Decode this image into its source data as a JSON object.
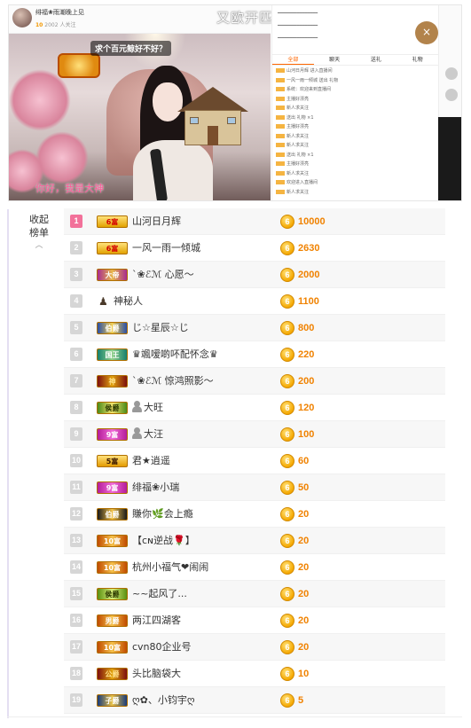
{
  "stream": {
    "anchor_name": "绯福❀雨潮晚上见",
    "anchor_meta_level": "10",
    "anchor_meta_text": "2002 人关注",
    "watermark": "又欧开匹哦走",
    "bubble": "求个百元鲸好不好？",
    "subtitle": "你好，我是大神",
    "subtitle_ghost": "……",
    "close_label": "×",
    "chat_tabs": [
      "全部",
      "聊天",
      "送礼",
      "礼物"
    ],
    "chat_lines": [
      "山河日月辉 进入直播间",
      "一风一雨一倾城 送出 礼物",
      "系统：欢迎来到直播间",
      "主播好漂亮",
      "新人求关注",
      "送出 礼物 ×1",
      "主播好漂亮",
      "新人求关注",
      "新人求关注",
      "送出 礼物 ×1",
      "主播好漂亮",
      "新人求关注",
      "欢迎进入直播间",
      "新人求关注"
    ]
  },
  "ranking": {
    "collapse_label": [
      "收起",
      "榜单"
    ],
    "collapse_icon": "︿",
    "coin_label": "6",
    "rows": [
      {
        "rank": "1",
        "badge": "6富",
        "badge_style": "b-red",
        "icon": "",
        "name": "山河日月辉",
        "value": "10000"
      },
      {
        "rank": "2",
        "badge": "6富",
        "badge_style": "b-red",
        "icon": "",
        "name": "一风一雨一倾城",
        "value": "2630"
      },
      {
        "rank": "3",
        "badge": "大帝",
        "badge_style": "b-purple",
        "icon": "",
        "name": "`❀ℰℳ 心愿～",
        "value": "2000"
      },
      {
        "rank": "4",
        "badge": "",
        "badge_style": "",
        "icon": "mystery",
        "name": "神秘人",
        "value": "1100"
      },
      {
        "rank": "5",
        "badge": "伯爵",
        "badge_style": "b-blue",
        "icon": "",
        "name": "じ☆星辰☆じ",
        "value": "800"
      },
      {
        "rank": "6",
        "badge": "国王",
        "badge_style": "b-teal",
        "icon": "",
        "name": "♛颯嗳啲吥配怀念♛",
        "value": "220"
      },
      {
        "rank": "7",
        "badge": "神",
        "badge_style": "b-darkred",
        "icon": "",
        "name": "`❀ℰℳ 惊鸿照影～",
        "value": "200"
      },
      {
        "rank": "8",
        "badge": "侯爵",
        "badge_style": "b-green",
        "icon": "person",
        "name": "大旺",
        "value": "120"
      },
      {
        "rank": "9",
        "badge": "9富",
        "badge_style": "b-magenta",
        "icon": "person",
        "name": "大汪",
        "value": "100"
      },
      {
        "rank": "10",
        "badge": "5富",
        "badge_style": "b-gold",
        "icon": "",
        "name": "君★逍遥",
        "value": "60"
      },
      {
        "rank": "11",
        "badge": "9富",
        "badge_style": "b-magenta",
        "icon": "",
        "name": "绯福❀小瑞",
        "value": "50"
      },
      {
        "rank": "12",
        "badge": "伯爵",
        "badge_style": "b-black",
        "icon": "",
        "name": "賺你🌿会上瘾",
        "value": "20"
      },
      {
        "rank": "13",
        "badge": "10富",
        "badge_style": "b-orange",
        "icon": "",
        "name": "【ᴄɴ逆战🌹】",
        "value": "20"
      },
      {
        "rank": "14",
        "badge": "10富",
        "badge_style": "b-orange",
        "icon": "",
        "name": "杭州小福气❤闹闹",
        "value": "20"
      },
      {
        "rank": "15",
        "badge": "侯爵",
        "badge_style": "b-lime",
        "icon": "",
        "name": "~~起风了...",
        "value": "20"
      },
      {
        "rank": "16",
        "badge": "男爵",
        "badge_style": "b-orange",
        "icon": "",
        "name": "两江四湖客",
        "value": "20"
      },
      {
        "rank": "17",
        "badge": "10富",
        "badge_style": "b-orange",
        "icon": "",
        "name": "cvn80企业号",
        "value": "20"
      },
      {
        "rank": "18",
        "badge": "公爵",
        "badge_style": "b-darkred",
        "icon": "",
        "name": "头比脑袋大",
        "value": "10"
      },
      {
        "rank": "19",
        "badge": "子爵",
        "badge_style": "b-navy",
        "icon": "",
        "name": "ღ✿、小钧宇ღ",
        "value": "5"
      }
    ]
  },
  "colors": {
    "accent": "#f08200",
    "first_rank": "#f2719a",
    "rank_default": "#d6d6d6"
  }
}
